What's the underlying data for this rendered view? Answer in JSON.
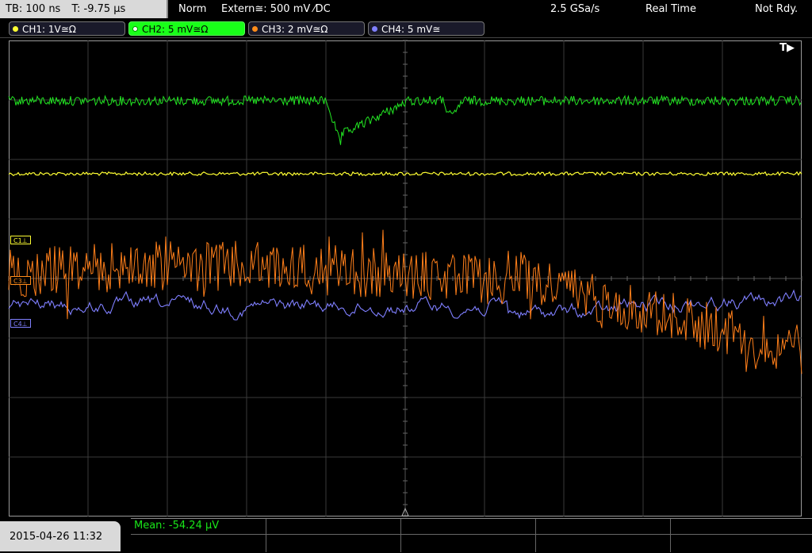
{
  "topbar": {
    "timebase": "TB: 100 ns",
    "trigger_time": "T: -9.75 µs",
    "mode": "Norm",
    "trigger_source": "Extern≅: 500 mV ⁄DC",
    "sample_rate": "2.5 GSa/s",
    "acq_mode": "Real Time",
    "status": "Not Rdy."
  },
  "channels": [
    {
      "label": "CH1: 1V≅Ω",
      "color": "#ffff33",
      "active": false
    },
    {
      "label": "CH2: 5 mV≅Ω",
      "color": "#19ff19",
      "active": true
    },
    {
      "label": "CH3: 2 mV≅Ω",
      "color": "#ff8c1a",
      "active": false
    },
    {
      "label": "CH4: 5 mV≅",
      "color": "#8080ff",
      "active": false
    }
  ],
  "markers": {
    "c1": "C1⊥",
    "c3": "C3⊥",
    "c4": "C4⊥"
  },
  "trigger_indicator": "T▶",
  "footer": {
    "datetime": "2015-04-26 11:32",
    "measurement": "Mean: -54.24 µV"
  }
}
